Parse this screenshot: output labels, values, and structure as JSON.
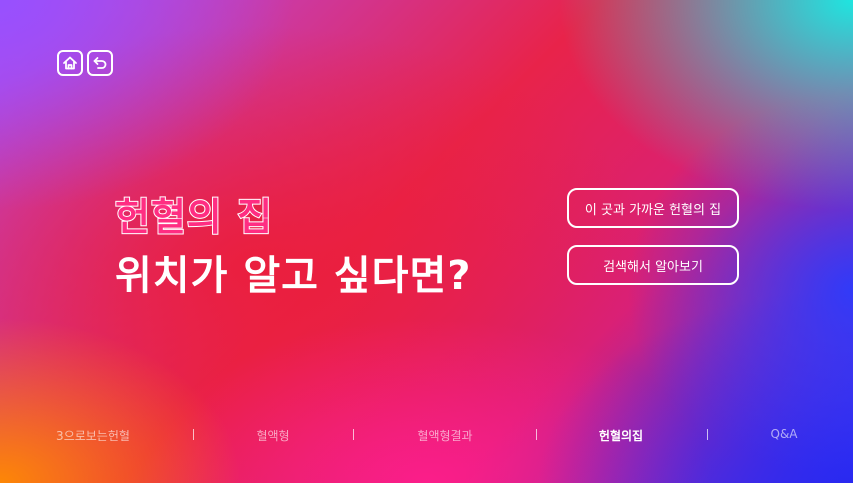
{
  "header": {
    "home_icon": "home-icon",
    "back_icon": "back-arrow-icon"
  },
  "main": {
    "title_line1": "헌혈의 집",
    "title_line2": "위치가 알고 싶다면?",
    "buttons": [
      {
        "label": "이 곳과 가까운 헌혈의 집"
      },
      {
        "label": "검색해서 알아보기"
      }
    ]
  },
  "nav": {
    "items": [
      {
        "label": "3으로보는헌혈"
      },
      {
        "label": "혈액형"
      },
      {
        "label": "혈액형결과"
      },
      {
        "label": "헌혈의집",
        "active": true
      },
      {
        "label": "Q&A"
      }
    ],
    "separator": "|"
  },
  "colors": {
    "title_accent": "#ff2d82",
    "text": "#ffffff"
  }
}
